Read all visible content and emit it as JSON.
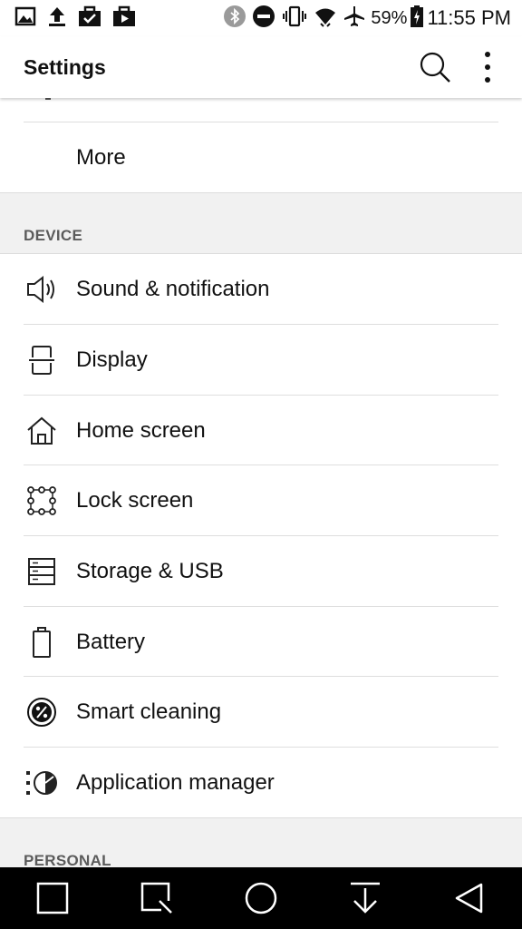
{
  "status_bar": {
    "left_icons": [
      "image-icon",
      "upload-icon",
      "briefcase-check-icon",
      "briefcase-play-icon"
    ],
    "right_icons": [
      "bluetooth-icon",
      "do-not-disturb-icon",
      "vibrate-icon",
      "wifi-icon",
      "airplane-icon",
      "battery-charging-icon"
    ],
    "battery_percent": "59%",
    "time": "11:55 PM"
  },
  "app_bar": {
    "title": "Settings",
    "actions": [
      "search-icon",
      "more-vert-icon"
    ]
  },
  "list": {
    "more_label": "More"
  },
  "device_section": {
    "title": "DEVICE",
    "items": [
      {
        "label": "Sound & notification",
        "icon": "speaker-icon"
      },
      {
        "label": "Display",
        "icon": "display-icon"
      },
      {
        "label": "Home screen",
        "icon": "home-icon"
      },
      {
        "label": "Lock screen",
        "icon": "lock-screen-icon"
      },
      {
        "label": "Storage & USB",
        "icon": "storage-icon"
      },
      {
        "label": "Battery",
        "icon": "battery-icon"
      },
      {
        "label": "Smart cleaning",
        "icon": "smart-cleaning-icon"
      },
      {
        "label": "Application manager",
        "icon": "app-manager-icon"
      }
    ]
  },
  "personal_section": {
    "title": "PERSONAL"
  },
  "nav_bar": {
    "buttons": [
      "recents-icon",
      "capture-icon",
      "home-icon",
      "notification-pull-icon",
      "back-icon"
    ]
  },
  "colors": {
    "background": "#ffffff",
    "section_background": "#f1f1f1",
    "nav_background": "#000000",
    "text": "#111111",
    "section_text": "#5b5b5b"
  }
}
